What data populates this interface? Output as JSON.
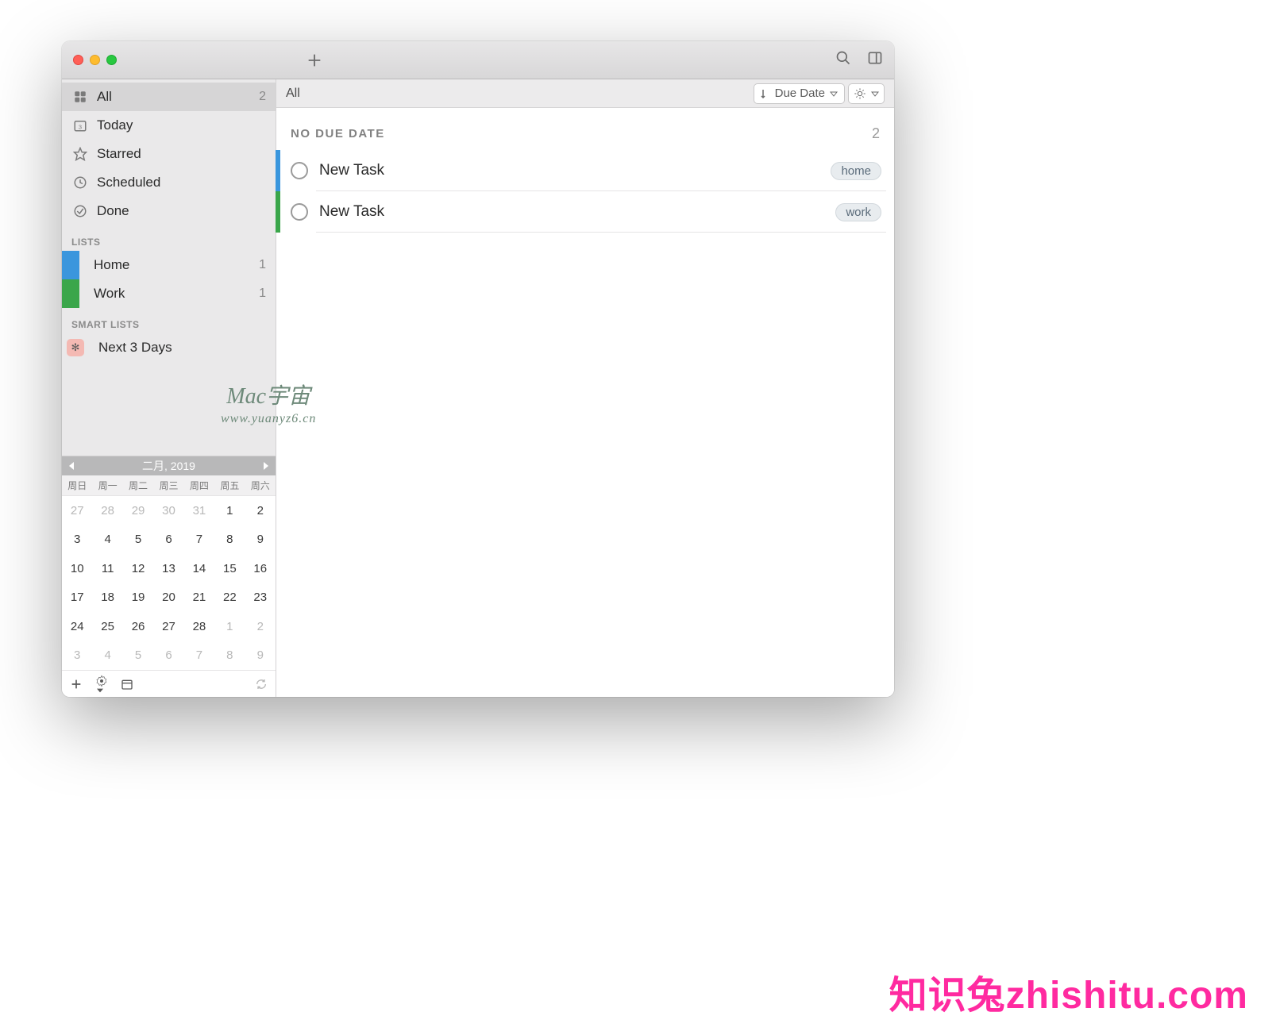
{
  "toolbar": {
    "sort_label": "Due Date"
  },
  "sidebar": {
    "filters": {
      "all": {
        "label": "All",
        "count": "2"
      },
      "today": {
        "label": "Today",
        "badge": "3"
      },
      "starred": {
        "label": "Starred"
      },
      "scheduled": {
        "label": "Scheduled"
      },
      "done": {
        "label": "Done"
      }
    },
    "lists_header": "LISTS",
    "lists": [
      {
        "label": "Home",
        "count": "1",
        "color": "blue"
      },
      {
        "label": "Work",
        "count": "1",
        "color": "green"
      }
    ],
    "smart_header": "SMART LISTS",
    "smart": [
      {
        "label": "Next 3 Days",
        "icon": "✻"
      }
    ]
  },
  "calendar": {
    "title": "二月, 2019",
    "dow": [
      "周日",
      "周一",
      "周二",
      "周三",
      "周四",
      "周五",
      "周六"
    ],
    "cells": [
      {
        "n": "27",
        "dim": true
      },
      {
        "n": "28",
        "dim": true
      },
      {
        "n": "29",
        "dim": true
      },
      {
        "n": "30",
        "dim": true
      },
      {
        "n": "31",
        "dim": true
      },
      {
        "n": "1"
      },
      {
        "n": "2"
      },
      {
        "n": "3"
      },
      {
        "n": "4"
      },
      {
        "n": "5"
      },
      {
        "n": "6"
      },
      {
        "n": "7"
      },
      {
        "n": "8"
      },
      {
        "n": "9"
      },
      {
        "n": "10"
      },
      {
        "n": "11"
      },
      {
        "n": "12"
      },
      {
        "n": "13"
      },
      {
        "n": "14"
      },
      {
        "n": "15"
      },
      {
        "n": "16"
      },
      {
        "n": "17"
      },
      {
        "n": "18"
      },
      {
        "n": "19"
      },
      {
        "n": "20"
      },
      {
        "n": "21"
      },
      {
        "n": "22"
      },
      {
        "n": "23"
      },
      {
        "n": "24"
      },
      {
        "n": "25"
      },
      {
        "n": "26"
      },
      {
        "n": "27"
      },
      {
        "n": "28"
      },
      {
        "n": "1",
        "dim": true
      },
      {
        "n": "2",
        "dim": true
      },
      {
        "n": "3",
        "dim": true
      },
      {
        "n": "4",
        "dim": true
      },
      {
        "n": "5",
        "dim": true
      },
      {
        "n": "6",
        "dim": true
      },
      {
        "n": "7",
        "dim": true
      },
      {
        "n": "8",
        "dim": true
      },
      {
        "n": "9",
        "dim": true
      }
    ]
  },
  "main": {
    "title": "All",
    "section_title": "NO DUE DATE",
    "section_count": "2",
    "tasks": [
      {
        "title": "New Task",
        "tag": "home",
        "stripe": "blue"
      },
      {
        "title": "New Task",
        "tag": "work",
        "stripe": "green"
      }
    ]
  },
  "watermark": {
    "line1": "Mac宇宙",
    "line2": "www.yuanyz6.cn"
  },
  "footermark": "知识兔zhishitu.com"
}
